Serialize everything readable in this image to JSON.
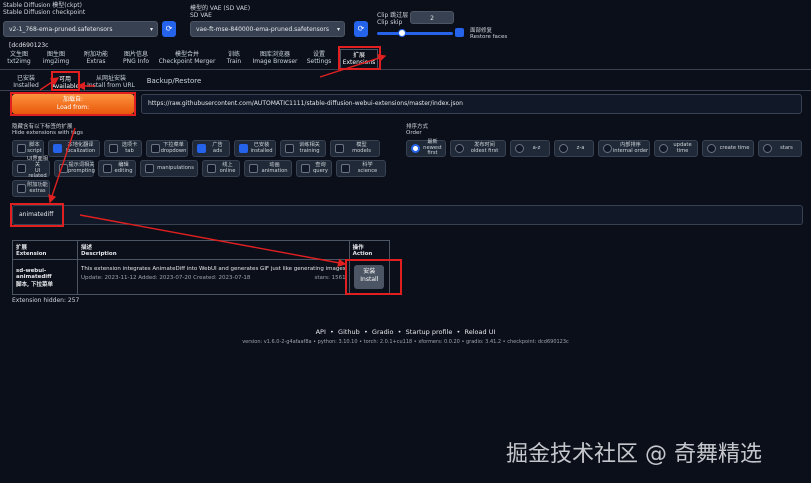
{
  "top": {
    "checkpoint_label": "Stable Diffusion 模型(ckpt)\nStable Diffusion checkpoint",
    "checkpoint_value": "v2-1_768-ema-pruned.safetensors [dcd690123c",
    "vae_label": "模型的 VAE (SD VAE)\nSD VAE",
    "vae_value": "vae-ft-mse-840000-ema-pruned.safetensors",
    "clip_label": "Clip 跳过层\nClip skip",
    "clip_value": "2",
    "restore_label": "面部修复\nRestore faces"
  },
  "tabs": [
    {
      "cn": "文生图",
      "en": "txt2img"
    },
    {
      "cn": "图生图",
      "en": "img2img"
    },
    {
      "cn": "附加功能",
      "en": "Extras"
    },
    {
      "cn": "图片信息",
      "en": "PNG Info"
    },
    {
      "cn": "模型合并",
      "en": "Checkpoint Merger"
    },
    {
      "cn": "训练",
      "en": "Train"
    },
    {
      "cn": "图库浏览器",
      "en": "Image Browser"
    },
    {
      "cn": "设置",
      "en": "Settings"
    },
    {
      "cn": "扩展",
      "en": "Extensions"
    }
  ],
  "subtabs": [
    {
      "cn": "已安装",
      "en": "Installed"
    },
    {
      "cn": "可用",
      "en": "Available"
    },
    {
      "cn": "从网址安装",
      "en": "Install from URL"
    },
    {
      "cn": "",
      "en": "Backup/Restore"
    }
  ],
  "load": {
    "cn": "加载自:",
    "en": "Load from:",
    "url": "https://raw.githubusercontent.com/AUTOMATIC1111/stable-diffusion-webui-extensions/master/index.json"
  },
  "hide_label": "隐藏含有以下标签的扩展\nHide extensions with tags",
  "order_label": "排序方式\nOrder",
  "tags": [
    {
      "cn": "脚本",
      "en": "script",
      "on": false
    },
    {
      "cn": "本地化翻译",
      "en": "localization",
      "on": true
    },
    {
      "cn": "选项卡",
      "en": "tab",
      "on": false
    },
    {
      "cn": "下拉菜单",
      "en": "dropdown",
      "on": false
    },
    {
      "cn": "广告",
      "en": "ads",
      "on": true
    },
    {
      "cn": "已安装",
      "en": "installed",
      "on": true
    },
    {
      "cn": "训练相关",
      "en": "training",
      "on": false
    },
    {
      "cn": "模型",
      "en": "models",
      "on": false
    },
    {
      "cn": "UI界面相关",
      "en": "UI related",
      "on": false
    },
    {
      "cn": "提示词相关",
      "en": "prompting",
      "on": false
    },
    {
      "cn": "编辑",
      "en": "editing",
      "on": false
    },
    {
      "cn": "",
      "en": "manipulations",
      "on": false
    },
    {
      "cn": "线上",
      "en": "online",
      "on": false
    },
    {
      "cn": "动画",
      "en": "animation",
      "on": false
    },
    {
      "cn": "查询",
      "en": "query",
      "on": false
    },
    {
      "cn": "科学",
      "en": "science",
      "on": false
    },
    {
      "cn": "附加功能",
      "en": "extras",
      "on": false
    }
  ],
  "orders": [
    {
      "cn": "最新",
      "en": "newest first",
      "on": true
    },
    {
      "cn": "发布时间",
      "en": "oldest first",
      "on": false
    },
    {
      "cn": "",
      "en": "a-z",
      "on": false
    },
    {
      "cn": "",
      "en": "z-a",
      "on": false
    },
    {
      "cn": "内部排序",
      "en": "internal order",
      "on": false
    },
    {
      "cn": "",
      "en": "update time",
      "on": false
    },
    {
      "cn": "",
      "en": "create time",
      "on": false
    },
    {
      "cn": "",
      "en": "stars",
      "on": false
    }
  ],
  "search_value": "animatediff",
  "table": {
    "headers": [
      {
        "cn": "扩展",
        "en": "Extension"
      },
      {
        "cn": "描述",
        "en": "Description"
      },
      {
        "cn": "操作",
        "en": "Action"
      }
    ],
    "row": {
      "name": "sd-webui-animatediff",
      "name2": "脚本, 下拉菜单",
      "desc": "This extension integrates AnimateDiff into WebUI and generates GIF just like generating images",
      "meta": "Update: 2023-11-12 Added: 2023-07-20 Created: 2023-07-18",
      "stars": "stars: 1561",
      "install_cn": "安装",
      "install_en": "Install"
    }
  },
  "hidden": "Extension hidden: 257",
  "footer": {
    "links": [
      "API",
      "Github",
      "Gradio",
      "Startup profile",
      "Reload UI"
    ],
    "sep": "•",
    "version": "version: v1.6.0-2-g4afaaf8a  •  python: 3.10.10  •  torch: 2.0.1+cu118  •  xformers: 0.0.20  •  gradio: 3.41.2  •  checkpoint: dcd690123c"
  },
  "watermark": "掘金技术社区 @ 奇舞精选",
  "refresh_icon": "refresh-icon",
  "colors": {
    "accent": "#2563eb",
    "orange": "#f97316",
    "annotation": "#e02020"
  }
}
